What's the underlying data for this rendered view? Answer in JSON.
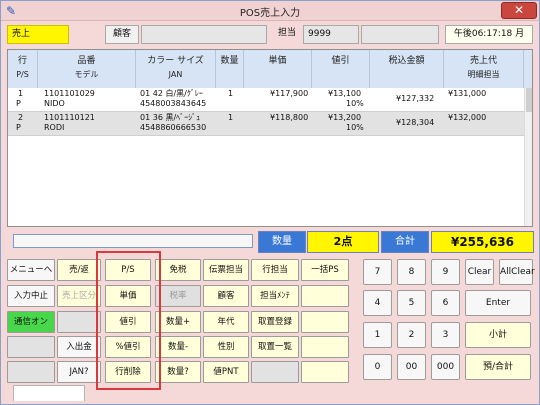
{
  "window": {
    "title": "POS売上入力",
    "close_label": "✕"
  },
  "header": {
    "mode": "売上",
    "customer_button": "顧客",
    "customer_value": "",
    "staff_label": "担当",
    "staff_value": "9999",
    "blank_value": "",
    "time": "午後06:17:18 月"
  },
  "grid": {
    "columns": [
      {
        "top": "行",
        "sub": "P/S"
      },
      {
        "top": "品番",
        "sub": "モデル"
      },
      {
        "top": "カラー サイズ",
        "sub": "JAN"
      },
      {
        "top": "数量",
        "sub": ""
      },
      {
        "top": "単価",
        "sub": ""
      },
      {
        "top": "値引",
        "sub": ""
      },
      {
        "top": "税込金額",
        "sub": ""
      },
      {
        "top": "売上代",
        "sub": "明細担当"
      }
    ],
    "rows": [
      {
        "line": "1",
        "ps": "P",
        "code": "1101101029",
        "model": "NIDO",
        "color_size": "01 42 白/黒/ｸﾞﾚｰ",
        "jan": "4548003843645",
        "qty": "1",
        "price": "¥117,900",
        "discount": "¥13,100",
        "discount_pct": "10%",
        "amount": "¥127,332",
        "sales": "¥131,000"
      },
      {
        "line": "2",
        "ps": "P",
        "code": "1101110121",
        "model": "RODI",
        "color_size": "01 36 黒/ﾍﾞｰｼﾞｭ",
        "jan": "4548860666530",
        "qty": "1",
        "price": "¥118,800",
        "discount": "¥13,200",
        "discount_pct": "10%",
        "amount": "¥128,304",
        "sales": "¥132,000"
      }
    ]
  },
  "totals": {
    "qty_label": "数量",
    "qty_value": "2点",
    "total_label": "合計",
    "total_value": "¥255,636"
  },
  "functions": {
    "menu": "メニューへ",
    "sales_return": "売/返",
    "input_stop": "入力中止",
    "sales_class": "売上区分",
    "comm_on": "通信オン",
    "cash_in_out": "入出金",
    "jan_q": "JAN?",
    "ps": "P/S",
    "unit_price": "単価",
    "discount": "値引",
    "pct_discount": "%値引",
    "row_delete": "行削除",
    "tax_free": "免税",
    "tax_rate": "税率",
    "qty_plus": "数量+",
    "qty_minus": "数量-",
    "qty_q": "数量?",
    "slip_staff": "伝票担当",
    "customer": "顧客",
    "age": "年代",
    "gender": "性別",
    "point_pnt": "値PNT",
    "line_staff": "行担当",
    "staff_maint": "担当ﾒﾝﾃ",
    "order_register": "取置登録",
    "order_list": "取置一覧",
    "bulk_ps": "一括PS"
  },
  "keypad": {
    "k7": "7",
    "k8": "8",
    "k9": "9",
    "clear": "Clear",
    "allclear": "AllClear",
    "k4": "4",
    "k5": "5",
    "k6": "6",
    "enter": "Enter",
    "k1": "1",
    "k2": "2",
    "k3": "3",
    "subtotal": "小計",
    "k0": "0",
    "k00": "00",
    "k000": "000",
    "deposit_total": "預/合計"
  },
  "colors": {
    "accent_blue": "#3a78d6",
    "total_yellow": "#fff600",
    "comm_green": "#48d64a",
    "highlight_red": "#d8393a"
  }
}
